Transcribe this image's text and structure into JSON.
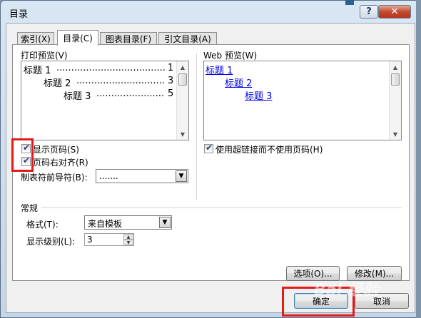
{
  "window": {
    "title": "目录",
    "help_glyph": "?",
    "close_glyph": "✕"
  },
  "tabs": [
    {
      "label": "索引(X)",
      "active": false
    },
    {
      "label": "目录(C)",
      "active": true
    },
    {
      "label": "图表目录(F)",
      "active": false
    },
    {
      "label": "引文目录(A)",
      "active": false
    }
  ],
  "print_preview": {
    "label": "打印预览(V)",
    "lines": [
      {
        "text": "标题 1",
        "page": "1"
      },
      {
        "text": "标题 2",
        "page": "3"
      },
      {
        "text": "标题 3",
        "page": "5"
      }
    ]
  },
  "web_preview": {
    "label": "Web 预览(W)",
    "links": [
      "标题 1",
      "标题 2",
      "标题 3"
    ]
  },
  "options": {
    "show_page_numbers": {
      "label": "显示页码(S)",
      "checked": true
    },
    "right_align": {
      "label": "页码右对齐(R)",
      "checked": true
    },
    "use_hyperlinks": {
      "label": "使用超链接而不使用页码(H)",
      "checked": true
    },
    "tab_leader_label": "制表符前导符(B):",
    "tab_leader_value": "......."
  },
  "general": {
    "title": "常规",
    "format_label": "格式(T):",
    "format_value": "来自模板",
    "levels_label": "显示级别(L):",
    "levels_value": "3"
  },
  "buttons": {
    "options": "选项(O)...",
    "modify": "修改(M)...",
    "ok": "确定",
    "cancel": "取消"
  },
  "icons": {
    "checkmark": "✔",
    "dropdown": "▼",
    "scroll_up": "▲",
    "scroll_down": "▼",
    "spin_up": "▲",
    "spin_down": "▼"
  },
  "watermark": "Bai 经验",
  "accent_colors": {
    "highlight": "#e61919",
    "link": "#0000ee"
  }
}
